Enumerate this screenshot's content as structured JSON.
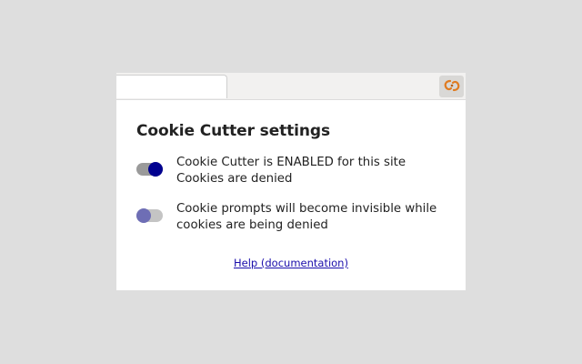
{
  "toolbar": {
    "extension_icon": "cookie-cutter-icon",
    "icon_color": "#e07b20"
  },
  "panel": {
    "title": "Cookie Cutter settings",
    "settings": [
      {
        "enabled": true,
        "line1": "Cookie Cutter is ENABLED for this site",
        "line2": "Cookies are denied"
      },
      {
        "enabled": false,
        "line1": "Cookie prompts will become invisible while",
        "line2": "cookies are being denied"
      }
    ],
    "help_link": "Help (documentation)"
  },
  "colors": {
    "toggle_on_knob": "#00008f",
    "toggle_off_knob": "#6e6eb5",
    "link": "#1a0dab"
  }
}
